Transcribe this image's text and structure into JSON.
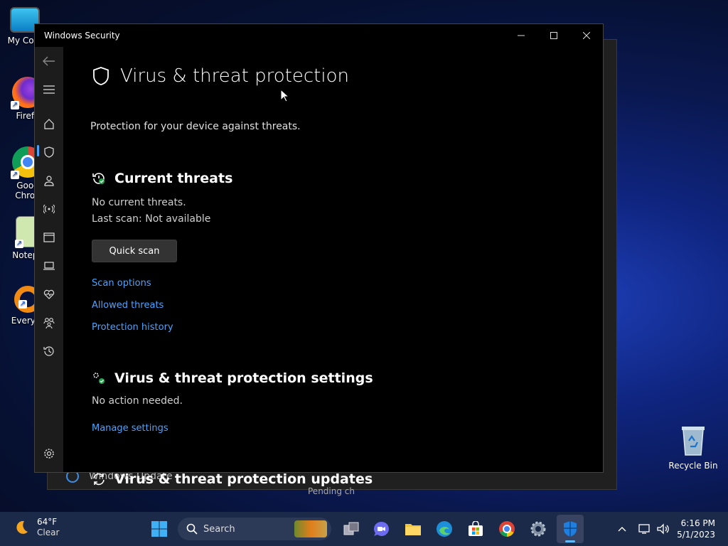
{
  "desktop": {
    "icons": [
      {
        "label": "My Com"
      },
      {
        "label": "Firefo"
      },
      {
        "label": "Goog Chron"
      },
      {
        "label": "Notepa"
      },
      {
        "label": "Everyth"
      }
    ],
    "recycle_bin": "Recycle Bin"
  },
  "background_window": {
    "item": "Windows Update",
    "partial_text": "Pending ch"
  },
  "window": {
    "title": "Windows Security",
    "page_title": "Virus & threat protection",
    "page_subtitle": "Protection for your device against threats.",
    "current_threats": {
      "title": "Current threats",
      "line1": "No current threats.",
      "line2": "Last scan: Not available",
      "button": "Quick scan",
      "links": [
        "Scan options",
        "Allowed threats",
        "Protection history"
      ]
    },
    "settings": {
      "title": "Virus & threat protection settings",
      "line1": "No action needed.",
      "link": "Manage settings"
    },
    "updates": {
      "title": "Virus & threat protection updates"
    },
    "nav_icons": [
      "back-arrow-icon",
      "hamburger-icon",
      "home-icon",
      "shield-icon",
      "account-icon",
      "firewall-icon",
      "app-browser-icon",
      "device-security-icon",
      "health-icon",
      "family-icon",
      "history-icon",
      "settings-icon"
    ]
  },
  "taskbar": {
    "weather_temp": "64°F",
    "weather_desc": "Clear",
    "search_label": "Search",
    "time": "6:16 PM",
    "date": "5/1/2023"
  },
  "colors": {
    "accent": "#4aa3ff",
    "window_bg": "#000000",
    "nav_bg": "#1c1c1c"
  }
}
